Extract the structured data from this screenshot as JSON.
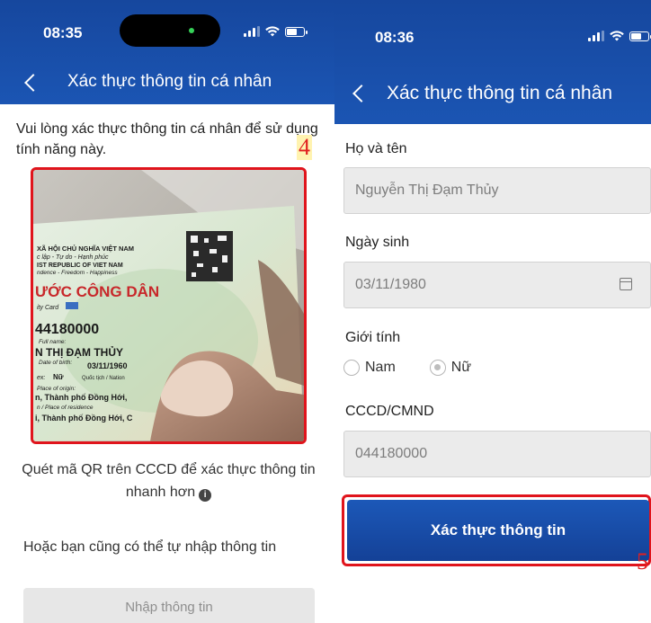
{
  "left": {
    "status": {
      "time": "08:35"
    },
    "nav_title": "Xác thực thông tin cá nhân",
    "intro": "Vui lòng xác thực thông tin cá nhân để sử dụng tính năng này.",
    "step_marker": "4",
    "card": {
      "line1": "XÃ HỘI CHỦ NGHĨA VIỆT NAM",
      "line2": "c lập - Tự do - Hạnh phúc",
      "line3": "IST REPUBLIC OF VIET NAM",
      "line4": "ndence - Freedom - Happiness",
      "title": "ƯỚC CÔNG DÂN",
      "card_label": "ity Card",
      "number": "44180000",
      "fullname_label": "Full name:",
      "name": "N THỊ ĐẠM THỦY",
      "dob_label": "Date of birth:",
      "dob": "03/11/1960",
      "sex_label": "ex:",
      "sex": "Nữ",
      "nationality": "Quốc tịch / Nation",
      "origin_label": "Place of origin:",
      "origin": "n, Thành phố Đồng Hới,",
      "residence_label": "n / Place of residence",
      "residence": "i, Thành phố Đồng Hới, C"
    },
    "qr_caption": "Quét mã QR trên CCCD để xác thực thông tin nhanh hơn",
    "info_glyph": "i",
    "alt_text": "Hoặc bạn cũng có thể tự nhập thông tin",
    "manual_button": "Nhập thông tin"
  },
  "right": {
    "status": {
      "time": "08:36"
    },
    "nav_title": "Xác thực thông tin cá nhân",
    "fullname": {
      "label": "Họ và tên",
      "value": "Nguyễn Thị Đạm Thủy"
    },
    "dob": {
      "label": "Ngày sinh",
      "value": "03/11/1980"
    },
    "gender": {
      "label": "Giới tính",
      "options": [
        "Nam",
        "Nữ"
      ],
      "selected": "Nữ"
    },
    "id": {
      "label": "CCCD/CMND",
      "value": "044180000"
    },
    "submit_button": "Xác thực thông tin",
    "step_marker": "5"
  },
  "colors": {
    "header_blue": "#1b55b3",
    "button_blue": "#1c58b8",
    "highlight_red": "#e0141c",
    "disabled_gray": "#e7e7e7"
  },
  "icons": [
    "back-chevron-icon",
    "signal-icon",
    "wifi-icon",
    "battery-icon",
    "calendar-icon",
    "info-icon"
  ]
}
